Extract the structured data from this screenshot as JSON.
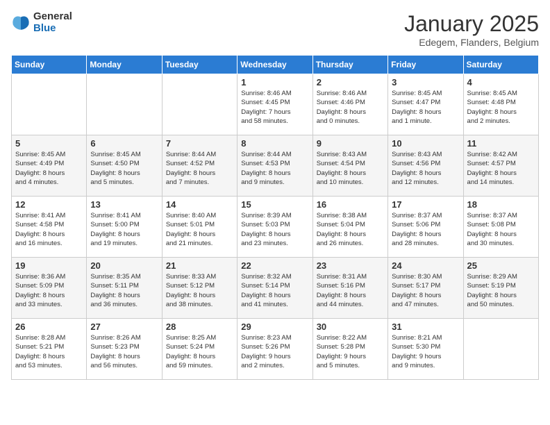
{
  "header": {
    "logo_general": "General",
    "logo_blue": "Blue",
    "month_title": "January 2025",
    "location": "Edegem, Flanders, Belgium"
  },
  "weekdays": [
    "Sunday",
    "Monday",
    "Tuesday",
    "Wednesday",
    "Thursday",
    "Friday",
    "Saturday"
  ],
  "weeks": [
    [
      {
        "day": "",
        "info": ""
      },
      {
        "day": "",
        "info": ""
      },
      {
        "day": "",
        "info": ""
      },
      {
        "day": "1",
        "info": "Sunrise: 8:46 AM\nSunset: 4:45 PM\nDaylight: 7 hours\nand 58 minutes."
      },
      {
        "day": "2",
        "info": "Sunrise: 8:46 AM\nSunset: 4:46 PM\nDaylight: 8 hours\nand 0 minutes."
      },
      {
        "day": "3",
        "info": "Sunrise: 8:45 AM\nSunset: 4:47 PM\nDaylight: 8 hours\nand 1 minute."
      },
      {
        "day": "4",
        "info": "Sunrise: 8:45 AM\nSunset: 4:48 PM\nDaylight: 8 hours\nand 2 minutes."
      }
    ],
    [
      {
        "day": "5",
        "info": "Sunrise: 8:45 AM\nSunset: 4:49 PM\nDaylight: 8 hours\nand 4 minutes."
      },
      {
        "day": "6",
        "info": "Sunrise: 8:45 AM\nSunset: 4:50 PM\nDaylight: 8 hours\nand 5 minutes."
      },
      {
        "day": "7",
        "info": "Sunrise: 8:44 AM\nSunset: 4:52 PM\nDaylight: 8 hours\nand 7 minutes."
      },
      {
        "day": "8",
        "info": "Sunrise: 8:44 AM\nSunset: 4:53 PM\nDaylight: 8 hours\nand 9 minutes."
      },
      {
        "day": "9",
        "info": "Sunrise: 8:43 AM\nSunset: 4:54 PM\nDaylight: 8 hours\nand 10 minutes."
      },
      {
        "day": "10",
        "info": "Sunrise: 8:43 AM\nSunset: 4:56 PM\nDaylight: 8 hours\nand 12 minutes."
      },
      {
        "day": "11",
        "info": "Sunrise: 8:42 AM\nSunset: 4:57 PM\nDaylight: 8 hours\nand 14 minutes."
      }
    ],
    [
      {
        "day": "12",
        "info": "Sunrise: 8:41 AM\nSunset: 4:58 PM\nDaylight: 8 hours\nand 16 minutes."
      },
      {
        "day": "13",
        "info": "Sunrise: 8:41 AM\nSunset: 5:00 PM\nDaylight: 8 hours\nand 19 minutes."
      },
      {
        "day": "14",
        "info": "Sunrise: 8:40 AM\nSunset: 5:01 PM\nDaylight: 8 hours\nand 21 minutes."
      },
      {
        "day": "15",
        "info": "Sunrise: 8:39 AM\nSunset: 5:03 PM\nDaylight: 8 hours\nand 23 minutes."
      },
      {
        "day": "16",
        "info": "Sunrise: 8:38 AM\nSunset: 5:04 PM\nDaylight: 8 hours\nand 26 minutes."
      },
      {
        "day": "17",
        "info": "Sunrise: 8:37 AM\nSunset: 5:06 PM\nDaylight: 8 hours\nand 28 minutes."
      },
      {
        "day": "18",
        "info": "Sunrise: 8:37 AM\nSunset: 5:08 PM\nDaylight: 8 hours\nand 30 minutes."
      }
    ],
    [
      {
        "day": "19",
        "info": "Sunrise: 8:36 AM\nSunset: 5:09 PM\nDaylight: 8 hours\nand 33 minutes."
      },
      {
        "day": "20",
        "info": "Sunrise: 8:35 AM\nSunset: 5:11 PM\nDaylight: 8 hours\nand 36 minutes."
      },
      {
        "day": "21",
        "info": "Sunrise: 8:33 AM\nSunset: 5:12 PM\nDaylight: 8 hours\nand 38 minutes."
      },
      {
        "day": "22",
        "info": "Sunrise: 8:32 AM\nSunset: 5:14 PM\nDaylight: 8 hours\nand 41 minutes."
      },
      {
        "day": "23",
        "info": "Sunrise: 8:31 AM\nSunset: 5:16 PM\nDaylight: 8 hours\nand 44 minutes."
      },
      {
        "day": "24",
        "info": "Sunrise: 8:30 AM\nSunset: 5:17 PM\nDaylight: 8 hours\nand 47 minutes."
      },
      {
        "day": "25",
        "info": "Sunrise: 8:29 AM\nSunset: 5:19 PM\nDaylight: 8 hours\nand 50 minutes."
      }
    ],
    [
      {
        "day": "26",
        "info": "Sunrise: 8:28 AM\nSunset: 5:21 PM\nDaylight: 8 hours\nand 53 minutes."
      },
      {
        "day": "27",
        "info": "Sunrise: 8:26 AM\nSunset: 5:23 PM\nDaylight: 8 hours\nand 56 minutes."
      },
      {
        "day": "28",
        "info": "Sunrise: 8:25 AM\nSunset: 5:24 PM\nDaylight: 8 hours\nand 59 minutes."
      },
      {
        "day": "29",
        "info": "Sunrise: 8:23 AM\nSunset: 5:26 PM\nDaylight: 9 hours\nand 2 minutes."
      },
      {
        "day": "30",
        "info": "Sunrise: 8:22 AM\nSunset: 5:28 PM\nDaylight: 9 hours\nand 5 minutes."
      },
      {
        "day": "31",
        "info": "Sunrise: 8:21 AM\nSunset: 5:30 PM\nDaylight: 9 hours\nand 9 minutes."
      },
      {
        "day": "",
        "info": ""
      }
    ]
  ]
}
